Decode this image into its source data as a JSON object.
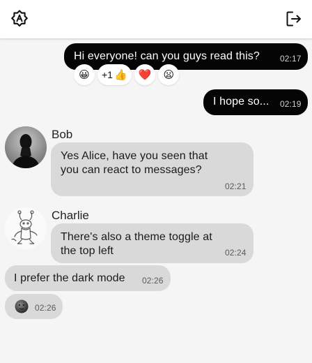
{
  "header": {
    "theme_icon": "theme-toggle-icon",
    "logout_icon": "logout-icon"
  },
  "messages": [
    {
      "text": "Hi everyone! can you guys read this?",
      "time": "02:17",
      "direction": "outgoing"
    },
    {
      "text": "I hope so...",
      "time": "02:19",
      "direction": "outgoing"
    },
    {
      "sender": "Bob",
      "text": "Yes Alice, have you seen that you can react to messages?",
      "time": "02:21",
      "direction": "incoming"
    },
    {
      "sender": "Charlie",
      "text": "There's also a theme toggle at the top left",
      "time": "02:24",
      "direction": "incoming"
    },
    {
      "text": "I prefer the dark mode",
      "time": "02:26",
      "direction": "incoming"
    },
    {
      "emoji": "dark-moon-face",
      "time": "02:26",
      "direction": "incoming"
    }
  ],
  "reactions": [
    {
      "emoji": "😀"
    },
    {
      "emoji": "👍",
      "count": "+1"
    },
    {
      "emoji": "❤️"
    },
    {
      "emoji": "😦"
    }
  ],
  "colors": {
    "outgoing_bubble": "#050505",
    "incoming_bubble": "#d9d9d9",
    "background": "#f5f5f5"
  }
}
